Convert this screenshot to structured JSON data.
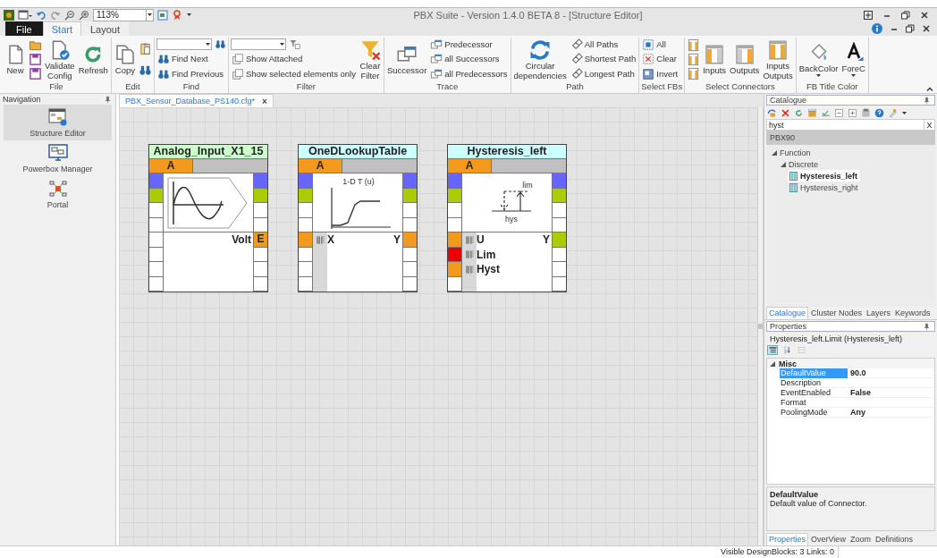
{
  "window": {
    "zoom": "113%",
    "title": "PBX Suite - Version 1.4.0 BETA 8 - [Structure Editor]"
  },
  "menu_tabs": [
    {
      "label": "File",
      "kind": "file",
      "selected": false
    },
    {
      "label": "Start",
      "kind": "tab",
      "selected": true
    },
    {
      "label": "Layout",
      "kind": "tab",
      "selected": false
    }
  ],
  "ribbon": [
    {
      "label": "File",
      "columns": [
        [
          {
            "kind": "large",
            "label": "New"
          }
        ],
        [
          {
            "kind": "icon"
          },
          {
            "kind": "icon"
          },
          {
            "kind": "icon"
          }
        ],
        [
          {
            "kind": "large",
            "label": "Validate Config"
          }
        ],
        [
          {
            "kind": "large",
            "label": "Refresh"
          }
        ]
      ]
    },
    {
      "label": "Edit",
      "columns": [
        [
          {
            "kind": "large",
            "label": "Copy"
          }
        ],
        [
          {
            "kind": "icon"
          },
          {
            "kind": "icon"
          }
        ]
      ]
    },
    {
      "label": "Find",
      "columns": [
        [
          {
            "kind": "combo"
          },
          {
            "kind": "small",
            "label": "Find Next"
          },
          {
            "kind": "small",
            "label": "Find Previous"
          }
        ]
      ]
    },
    {
      "label": "Filter",
      "columns": [
        [
          {
            "kind": "combo"
          },
          {
            "kind": "small",
            "label": "Show Attached"
          },
          {
            "kind": "small",
            "label": "Show selected elements only"
          }
        ],
        [
          {
            "kind": "large",
            "label": "Clear Filter"
          }
        ]
      ]
    },
    {
      "label": "Trace",
      "columns": [
        [
          {
            "kind": "large",
            "label": "Successor"
          }
        ],
        [
          {
            "kind": "small",
            "label": "Predecessor"
          },
          {
            "kind": "small",
            "label": "all Successors"
          },
          {
            "kind": "small",
            "label": "all Predecessors"
          }
        ]
      ]
    },
    {
      "label": "Path",
      "columns": [
        [
          {
            "kind": "large",
            "label": "Circular dependencies"
          }
        ],
        [
          {
            "kind": "small",
            "label": "All Paths"
          },
          {
            "kind": "small",
            "label": "Shortest Path"
          },
          {
            "kind": "small",
            "label": "Longest Path"
          }
        ]
      ]
    },
    {
      "label": "Select FBs",
      "columns": [
        [
          {
            "kind": "small",
            "label": "All"
          },
          {
            "kind": "small",
            "label": "Clear"
          },
          {
            "kind": "small",
            "label": "Invert"
          }
        ]
      ]
    },
    {
      "label": "Select Connectors",
      "columns": [
        [
          {
            "kind": "icon"
          },
          {
            "kind": "icon"
          },
          {
            "kind": "icon"
          }
        ],
        [
          {
            "kind": "large",
            "label": "Inputs"
          }
        ],
        [
          {
            "kind": "large",
            "label": "Outputs"
          }
        ],
        [
          {
            "kind": "large",
            "label": "Inputs Outputs"
          }
        ]
      ]
    },
    {
      "label": "FB Title Color",
      "columns": [
        [
          {
            "kind": "large",
            "label": "BackColor",
            "dropdown": true
          }
        ],
        [
          {
            "kind": "large",
            "label": "ForeC",
            "dropdown": true
          }
        ]
      ]
    }
  ],
  "navigation": {
    "title": "Navigation",
    "items": [
      {
        "label": "Structure Editor",
        "selected": true
      },
      {
        "label": "Powerbox Manager",
        "selected": false
      },
      {
        "label": "Portal",
        "selected": false
      }
    ]
  },
  "document_tab": {
    "label": "PBX_Sensor_Database_PS140.cfg*",
    "close": "×"
  },
  "blocks": [
    {
      "title": "Analog_Input_X1_15",
      "color": "#ccffcc",
      "header": "A",
      "kind": "sine",
      "left": [
        {
          "color": "#6666ff"
        },
        {
          "color": "#aacc00"
        },
        {
          "color": "#ffffff"
        },
        {
          "color": "#ffffff"
        },
        {
          "color": "#ffffff"
        },
        {
          "color": "#ffffff"
        },
        {
          "color": "#ffffff"
        },
        {
          "color": "#ffffff"
        }
      ],
      "right": [
        {
          "color": "#6666ff"
        },
        {
          "color": "#aacc00"
        },
        {
          "color": "#ffffff"
        },
        {
          "color": "#ffffff"
        },
        {
          "color": "#f39a1e",
          "label": "E"
        },
        {
          "color": "#ffffff"
        },
        {
          "color": "#ffffff"
        },
        {
          "color": "#ffffff"
        }
      ],
      "io": [
        {
          "output": "Volt"
        }
      ]
    },
    {
      "title": "OneDLookupTable",
      "color": "#ccffff",
      "header": "A",
      "kind": "lookup",
      "picture_labels": [
        "1-D T (u)"
      ],
      "left": [
        {
          "color": "#6666ff"
        },
        {
          "color": "#aacc00"
        },
        {
          "color": "#ffffff"
        },
        {
          "color": "#ffffff"
        },
        {
          "color": "#f39a1e"
        },
        {
          "color": "#ffffff"
        },
        {
          "color": "#ffffff"
        },
        {
          "color": "#ffffff"
        }
      ],
      "right": [
        {
          "color": "#6666ff"
        },
        {
          "color": "#aacc00"
        },
        {
          "color": "#ffffff"
        },
        {
          "color": "#ffffff"
        },
        {
          "color": "#f39a1e"
        },
        {
          "color": "#ffffff"
        },
        {
          "color": "#ffffff"
        },
        {
          "color": "#ffffff"
        }
      ],
      "io": [
        {
          "input": "X",
          "output": "Y"
        }
      ]
    },
    {
      "title": "Hysteresis_left",
      "color": "#ccffff",
      "header": "A",
      "kind": "hysteresis",
      "picture_labels": [
        "lim",
        "hys"
      ],
      "left": [
        {
          "color": "#6666ff"
        },
        {
          "color": "#aacc00"
        },
        {
          "color": "#ffffff"
        },
        {
          "color": "#ffffff"
        },
        {
          "color": "#f39a1e"
        },
        {
          "color": "#ee0000"
        },
        {
          "color": "#f39a1e"
        },
        {
          "color": "#ffffff"
        }
      ],
      "right": [
        {
          "color": "#6666ff"
        },
        {
          "color": "#aacc00"
        },
        {
          "color": "#ffffff"
        },
        {
          "color": "#ffffff"
        },
        {
          "color": "#aacc00"
        },
        {
          "color": "#ffffff"
        },
        {
          "color": "#ffffff"
        },
        {
          "color": "#ffffff"
        }
      ],
      "io": [
        {
          "input": "U",
          "output": "Y"
        },
        {
          "input": "Lim"
        },
        {
          "input": "Hyst"
        }
      ]
    }
  ],
  "catalogue": {
    "title": "Catalogue",
    "search": "hyst",
    "clear": "X",
    "library": "PBX90",
    "tree": [
      {
        "label": "Function",
        "expanded": true,
        "children": [
          {
            "label": "Discrete",
            "expanded": true,
            "children": [
              {
                "label": "Hysteresis_left",
                "selected": true
              },
              {
                "label": "Hysteresis_right",
                "selected": false
              }
            ]
          }
        ]
      }
    ],
    "tabs": [
      {
        "label": "Catalogue",
        "selected": true
      },
      {
        "label": "Cluster Nodes",
        "selected": false
      },
      {
        "label": "Layers",
        "selected": false
      },
      {
        "label": "Keywords",
        "selected": false
      }
    ]
  },
  "properties": {
    "title": "Properties",
    "subject": "Hysteresis_left.Limit (Hysteresis_left)",
    "view_buttons": [
      {
        "selected": true
      },
      {
        "selected": false
      },
      {
        "selected": false
      }
    ],
    "category": {
      "label": "Misc",
      "expanded": true,
      "rows": [
        {
          "name": "DefaultValue",
          "value": "90.0",
          "selected": true
        },
        {
          "name": "Description",
          "selected": false
        },
        {
          "name": "EventEnabled",
          "value": "False",
          "selected": false
        },
        {
          "name": "Format",
          "selected": false
        },
        {
          "name": "PoolingMode",
          "value": "Any",
          "selected": false
        }
      ]
    },
    "help_title": "DefaultValue",
    "help_text": "Default value of Connector.",
    "tabs": [
      {
        "label": "Properties",
        "selected": true
      },
      {
        "label": "OverView",
        "selected": false
      },
      {
        "label": "Zoom",
        "selected": false
      },
      {
        "label": "Definitions",
        "selected": false
      }
    ]
  },
  "status_bar": "Visible DesignBlocks: 3 Links: 0"
}
